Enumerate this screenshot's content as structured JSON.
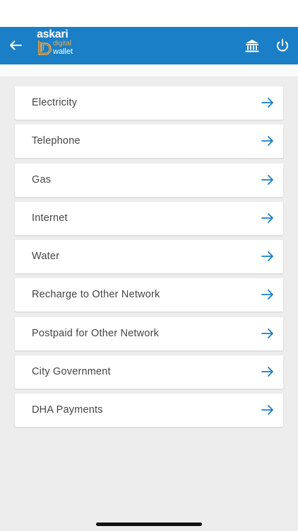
{
  "app": {
    "logo_brand": "askari",
    "logo_sub1": "digital",
    "logo_sub2": "wallet"
  },
  "colors": {
    "app_bar": "#1a7fc6",
    "arrow": "#1a7fc6",
    "logo_accent": "#f2a640",
    "background": "#ededed"
  },
  "icons": {
    "back": "arrow-left",
    "bank": "bank-building",
    "power": "power",
    "item_arrow": "arrow-right"
  },
  "bill_categories": [
    {
      "label": "Electricity"
    },
    {
      "label": "Telephone"
    },
    {
      "label": "Gas"
    },
    {
      "label": "Internet"
    },
    {
      "label": "Water"
    },
    {
      "label": "Recharge to Other Network"
    },
    {
      "label": "Postpaid for Other Network"
    },
    {
      "label": "City Government"
    },
    {
      "label": "DHA Payments"
    }
  ]
}
